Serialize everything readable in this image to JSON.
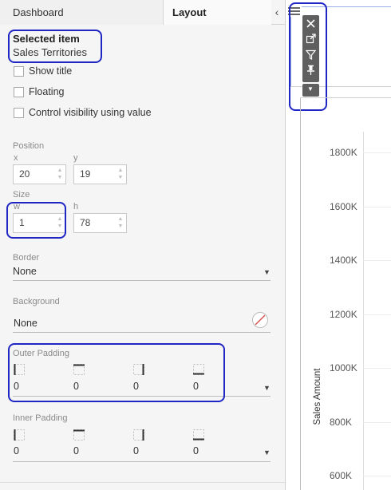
{
  "tabs": {
    "dashboard": "Dashboard",
    "layout": "Layout"
  },
  "collapse_glyph": "‹",
  "selected": {
    "heading": "Selected item",
    "name": "Sales Territories"
  },
  "options": [
    {
      "label": "Show title"
    },
    {
      "label": "Floating"
    },
    {
      "label": "Control visibility using value"
    }
  ],
  "position": {
    "heading": "Position",
    "x_label": "x",
    "y_label": "y",
    "x": "20",
    "y": "19"
  },
  "size": {
    "heading": "Size",
    "w_label": "w",
    "h_label": "h",
    "w": "1",
    "h": "78"
  },
  "border": {
    "heading": "Border",
    "value": "None"
  },
  "background": {
    "heading": "Background",
    "value": "None"
  },
  "outer_padding": {
    "heading": "Outer Padding",
    "values": [
      "0",
      "0",
      "0",
      "0"
    ]
  },
  "inner_padding": {
    "heading": "Inner Padding",
    "values": [
      "0",
      "0",
      "0",
      "0"
    ]
  },
  "chart_data": {
    "type": "axis",
    "ylabel": "Sales Amount",
    "ticks": [
      "1800K",
      "1600K",
      "1400K",
      "1200K",
      "1000K",
      "800K",
      "600K"
    ]
  },
  "colors": {
    "highlight": "#1f26c4",
    "toolbar": "#5f5f5f",
    "no_color": "#d9534f"
  },
  "icons": [
    "close-icon",
    "open-external-icon",
    "filter-icon",
    "pin-icon",
    "more-caret-icon",
    "hamburger-icon"
  ]
}
